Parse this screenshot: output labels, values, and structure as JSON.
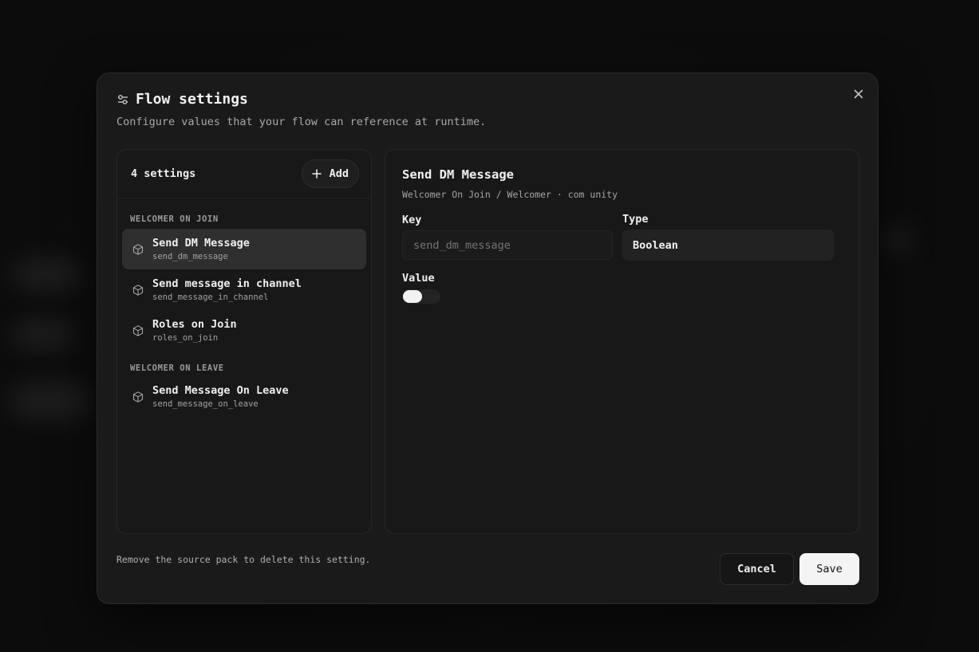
{
  "dialog": {
    "title": "Flow settings",
    "subtitle": "Configure values that your flow can reference at runtime.",
    "icons": {
      "title": "sliders-icon",
      "close": "close-icon"
    }
  },
  "list": {
    "count_label": "4 settings",
    "add_label": "Add",
    "groups": [
      {
        "label": "WELCOMER ON JOIN",
        "items": [
          {
            "label": "Send DM Message",
            "key": "send_dm_message",
            "active": true
          },
          {
            "label": "Send message in channel",
            "key": "send_message_in_channel",
            "active": false
          },
          {
            "label": "Roles on Join",
            "key": "roles_on_join",
            "active": false
          }
        ]
      },
      {
        "label": "WELCOMER ON LEAVE",
        "items": [
          {
            "label": "Send Message On Leave",
            "key": "send_message_on_leave",
            "active": false
          }
        ]
      }
    ]
  },
  "detail": {
    "title": "Send DM Message",
    "path": "Welcomer On Join / Welcomer · com unity",
    "key_label": "Key",
    "key_placeholder": "send_dm_message",
    "type_label": "Type",
    "type_value": "Boolean",
    "value_label": "Value",
    "value_on": false
  },
  "footer": {
    "note": "Remove the source pack to delete this setting.",
    "cancel_label": "Cancel",
    "save_label": "Save"
  }
}
